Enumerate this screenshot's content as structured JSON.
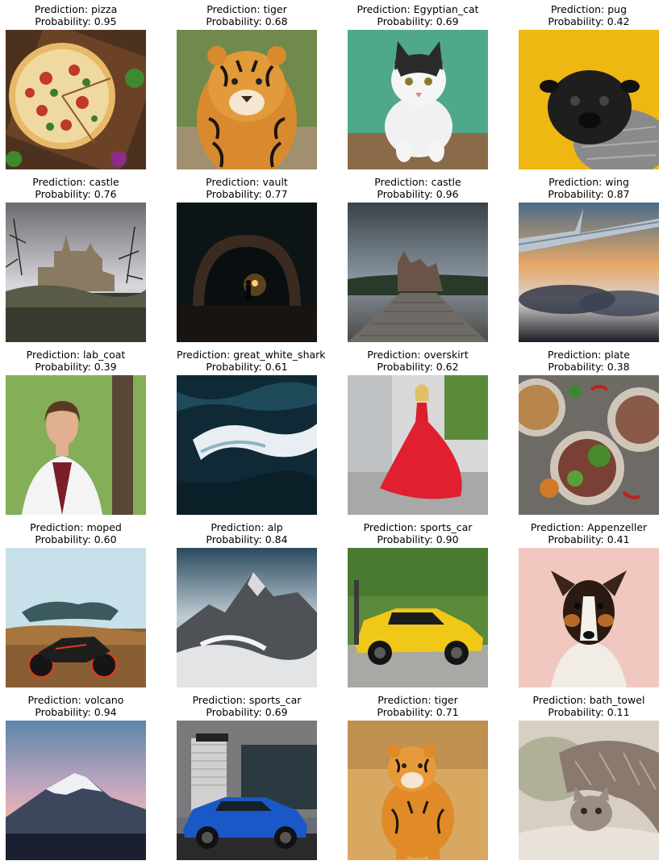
{
  "labels": {
    "prediction_prefix": "Prediction: ",
    "probability_prefix": "Probability: "
  },
  "cells": [
    {
      "prediction": "pizza",
      "probability": "0.95",
      "image": "pizza-photo"
    },
    {
      "prediction": "tiger",
      "probability": "0.68",
      "image": "tiger-photo"
    },
    {
      "prediction": "Egyptian_cat",
      "probability": "0.69",
      "image": "cat-photo"
    },
    {
      "prediction": "pug",
      "probability": "0.42",
      "image": "pug-photo"
    },
    {
      "prediction": "castle",
      "probability": "0.76",
      "image": "castle-photo"
    },
    {
      "prediction": "vault",
      "probability": "0.77",
      "image": "tunnel-photo"
    },
    {
      "prediction": "castle",
      "probability": "0.96",
      "image": "castle-road-photo"
    },
    {
      "prediction": "wing",
      "probability": "0.87",
      "image": "airplane-wing-photo"
    },
    {
      "prediction": "lab_coat",
      "probability": "0.39",
      "image": "woman-lab-coat-photo"
    },
    {
      "prediction": "great_white_shark",
      "probability": "0.61",
      "image": "ocean-waves-photo"
    },
    {
      "prediction": "overskirt",
      "probability": "0.62",
      "image": "red-dress-photo"
    },
    {
      "prediction": "plate",
      "probability": "0.38",
      "image": "food-plates-photo"
    },
    {
      "prediction": "moped",
      "probability": "0.60",
      "image": "motorcycle-photo"
    },
    {
      "prediction": "alp",
      "probability": "0.84",
      "image": "mountain-photo"
    },
    {
      "prediction": "sports_car",
      "probability": "0.90",
      "image": "yellow-sports-car-photo"
    },
    {
      "prediction": "Appenzeller",
      "probability": "0.41",
      "image": "dog-photo"
    },
    {
      "prediction": "volcano",
      "probability": "0.94",
      "image": "snowy-peak-photo"
    },
    {
      "prediction": "sports_car",
      "probability": "0.69",
      "image": "blue-car-photo"
    },
    {
      "prediction": "tiger",
      "probability": "0.71",
      "image": "walking-tiger-photo"
    },
    {
      "prediction": "bath_towel",
      "probability": "0.11",
      "image": "cat-blanket-photo"
    }
  ]
}
